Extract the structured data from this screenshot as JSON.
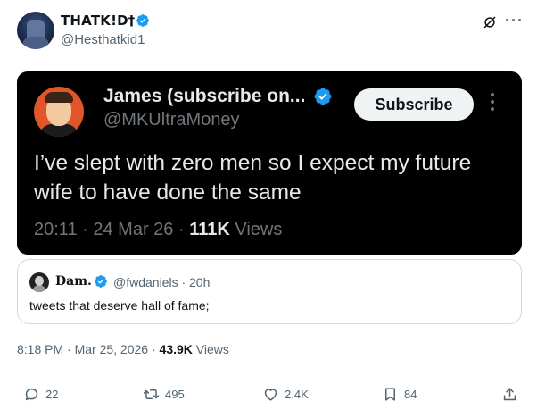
{
  "author": {
    "display_name": "THATK!D†",
    "handle": "@Hesthatkid1"
  },
  "header_icons": [
    "grok-icon",
    "more-icon"
  ],
  "embedded_screenshot": {
    "display_name": "James (subscribe on...",
    "handle": "@MKUltraMoney",
    "subscribe_label": "Subscribe",
    "text": "I’ve slept with zero men so I expect my future wife to have done the same",
    "time": "20:11",
    "date": "24 Mar 26",
    "views_count": "111K",
    "views_label": "Views"
  },
  "quoted_tweet": {
    "display_name": "Dam.",
    "handle_time": "@fwdaniels · 20h",
    "text": "tweets that deserve hall of fame;"
  },
  "meta": {
    "timestamp": "8:18 PM · Mar 25, 2026 · ",
    "views_count": "43.9K",
    "views_label": " Views"
  },
  "actions": {
    "replies": "22",
    "reposts": "495",
    "likes": "2.4K",
    "bookmarks": "84"
  },
  "colors": {
    "verified": "#1d9bf0",
    "dark_card": "#000000",
    "secondary_text": "#536471"
  }
}
